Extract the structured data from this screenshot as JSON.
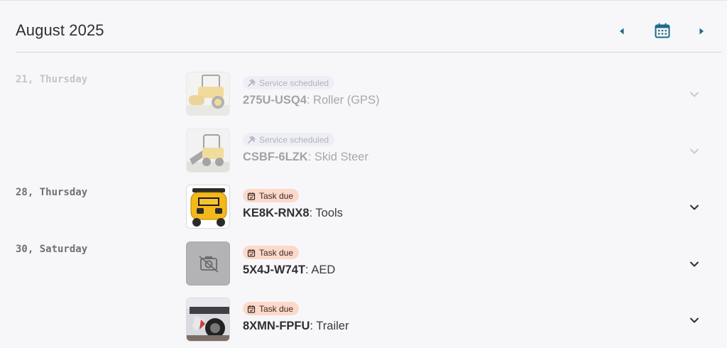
{
  "header": {
    "month_title": "August 2025",
    "accent_color": "#1e6a8a"
  },
  "days": [
    {
      "label": "21, Thursday",
      "faded": true
    },
    {
      "label": "28, Thursday",
      "faded": false
    },
    {
      "label": "30, Saturday",
      "faded": false
    }
  ],
  "events": [
    {
      "badge_icon": "tools-icon",
      "badge": "Service scheduled",
      "asset_id": "275U-USQ4",
      "separator": ":",
      "asset_name": " Roller (GPS)",
      "thumbnail": "roller-photo",
      "faded": true
    },
    {
      "badge_icon": "tools-icon",
      "badge": "Service scheduled",
      "asset_id": "CSBF-6LZK",
      "separator": ":",
      "asset_name": " Skid Steer",
      "thumbnail": "skid-steer-photo",
      "faded": true
    },
    {
      "badge_icon": "calendar-check-icon",
      "badge": "Task due",
      "asset_id": "KE8K-RNX8",
      "separator": ":",
      "asset_name": " Tools",
      "thumbnail": "compressor-photo",
      "faded": false
    },
    {
      "badge_icon": "calendar-check-icon",
      "badge": "Task due",
      "asset_id": "5X4J-W74T",
      "separator": ":",
      "asset_name": " AED",
      "thumbnail": "no-photo-icon",
      "faded": false
    },
    {
      "badge_icon": "calendar-check-icon",
      "badge": "Task due",
      "asset_id": "8XMN-FPFU",
      "separator": ":",
      "asset_name": " Trailer",
      "thumbnail": "trailer-photo",
      "faded": false
    }
  ]
}
